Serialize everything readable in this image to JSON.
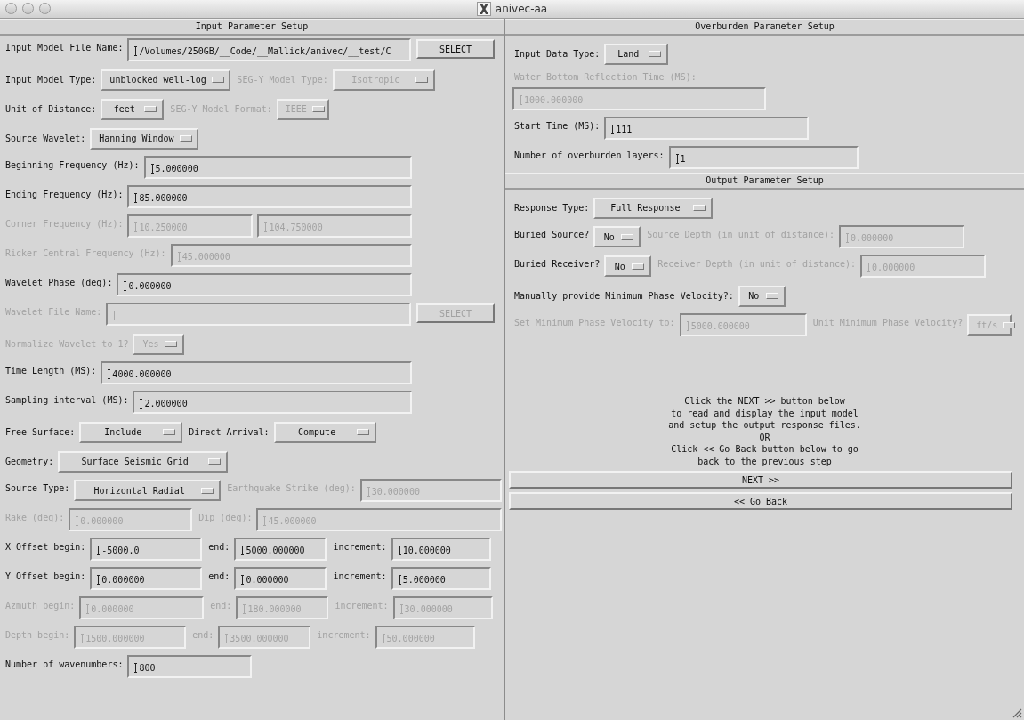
{
  "window": {
    "title": "anivec-aa"
  },
  "input": {
    "title": "Input Parameter Setup",
    "rows": [
      {
        "items": [
          {
            "kind": "label",
            "text": "Input Model File Name:",
            "disabled": false
          },
          {
            "kind": "field",
            "value": "/Volumes/250GB/__Code/__Mallick/anivec/__test/C",
            "disabled": false
          },
          {
            "kind": "button",
            "text": "SELECT",
            "disabled": false
          }
        ]
      },
      {
        "items": [
          {
            "kind": "label",
            "text": "Input Model Type:",
            "disabled": false
          },
          {
            "kind": "menu",
            "text": "unblocked well-log",
            "disabled": false
          },
          {
            "kind": "label",
            "text": "SEG-Y Model Type:",
            "disabled": true
          },
          {
            "kind": "menu",
            "text": "Isotropic",
            "disabled": true
          }
        ]
      },
      {
        "items": [
          {
            "kind": "label",
            "text": "Unit of Distance:",
            "disabled": false
          },
          {
            "kind": "menu",
            "text": "feet",
            "disabled": false
          },
          {
            "kind": "label",
            "text": "SEG-Y Model Format:",
            "disabled": true
          },
          {
            "kind": "menu",
            "text": "IEEE",
            "disabled": true
          }
        ]
      },
      {
        "items": [
          {
            "kind": "label",
            "text": "Source Wavelet:",
            "disabled": false
          },
          {
            "kind": "menu",
            "text": "Hanning Window",
            "disabled": false
          }
        ]
      },
      {
        "items": [
          {
            "kind": "label",
            "text": "Beginning Frequency (Hz):",
            "disabled": false
          },
          {
            "kind": "field",
            "value": "5.000000",
            "disabled": false
          }
        ]
      },
      {
        "items": [
          {
            "kind": "label",
            "text": "Ending Frequency (Hz):",
            "disabled": false
          },
          {
            "kind": "field",
            "value": "85.000000",
            "disabled": false
          }
        ]
      },
      {
        "items": [
          {
            "kind": "label",
            "text": "Corner Frequency (Hz):",
            "disabled": true
          },
          {
            "kind": "field",
            "value": "10.250000",
            "disabled": true
          },
          {
            "kind": "field",
            "value": "104.750000",
            "disabled": true
          }
        ]
      },
      {
        "items": [
          {
            "kind": "label",
            "text": "Ricker Central Frequency (Hz):",
            "disabled": true
          },
          {
            "kind": "field",
            "value": "45.000000",
            "disabled": true
          }
        ]
      },
      {
        "items": [
          {
            "kind": "label",
            "text": "Wavelet Phase (deg):",
            "disabled": false
          },
          {
            "kind": "field",
            "value": "0.000000",
            "disabled": false
          }
        ]
      },
      {
        "items": [
          {
            "kind": "label",
            "text": "Wavelet File Name:",
            "disabled": true
          },
          {
            "kind": "field",
            "value": "",
            "disabled": true
          },
          {
            "kind": "button",
            "text": "SELECT",
            "disabled": true
          }
        ]
      },
      {
        "items": [
          {
            "kind": "label",
            "text": "Normalize Wavelet to 1?",
            "disabled": true
          },
          {
            "kind": "menu",
            "text": "Yes",
            "disabled": true
          }
        ]
      },
      {
        "items": [
          {
            "kind": "label",
            "text": "Time Length (MS):",
            "disabled": false
          },
          {
            "kind": "field",
            "value": "4000.000000",
            "disabled": false
          }
        ]
      },
      {
        "items": [
          {
            "kind": "label",
            "text": "Sampling interval (MS):",
            "disabled": false
          },
          {
            "kind": "field",
            "value": "2.000000",
            "disabled": false
          }
        ]
      },
      {
        "items": [
          {
            "kind": "label",
            "text": "Free Surface:",
            "disabled": false
          },
          {
            "kind": "menu",
            "text": "Include",
            "disabled": false
          },
          {
            "kind": "label",
            "text": "Direct Arrival:",
            "disabled": false
          },
          {
            "kind": "menu",
            "text": "Compute",
            "disabled": false
          }
        ]
      },
      {
        "items": [
          {
            "kind": "label",
            "text": "Geometry:",
            "disabled": false
          },
          {
            "kind": "menu",
            "text": "Surface Seismic Grid",
            "disabled": false
          }
        ]
      },
      {
        "items": [
          {
            "kind": "label",
            "text": "Source Type:",
            "disabled": false
          },
          {
            "kind": "menu",
            "text": "Horizontal Radial",
            "disabled": false
          },
          {
            "kind": "label",
            "text": "Earthquake Strike (deg):",
            "disabled": true
          },
          {
            "kind": "field",
            "value": "30.000000",
            "disabled": true
          }
        ]
      },
      {
        "items": [
          {
            "kind": "label",
            "text": "Rake (deg):",
            "disabled": true
          },
          {
            "kind": "field",
            "value": "0.000000",
            "disabled": true
          },
          {
            "kind": "label",
            "text": "Dip (deg):",
            "disabled": true
          },
          {
            "kind": "field",
            "value": "45.000000",
            "disabled": true
          }
        ]
      },
      {
        "items": [
          {
            "kind": "label",
            "text": "X Offset begin:",
            "disabled": false
          },
          {
            "kind": "field",
            "value": "-5000.0",
            "disabled": false
          },
          {
            "kind": "label",
            "text": "end:",
            "disabled": false
          },
          {
            "kind": "field",
            "value": "5000.000000",
            "disabled": false
          },
          {
            "kind": "label",
            "text": "increment:",
            "disabled": false
          },
          {
            "kind": "field",
            "value": "10.000000",
            "disabled": false
          }
        ]
      },
      {
        "items": [
          {
            "kind": "label",
            "text": "Y Offset begin:",
            "disabled": false
          },
          {
            "kind": "field",
            "value": "0.000000",
            "disabled": false
          },
          {
            "kind": "label",
            "text": "end:",
            "disabled": false
          },
          {
            "kind": "field",
            "value": "0.000000",
            "disabled": false
          },
          {
            "kind": "label",
            "text": "increment:",
            "disabled": false
          },
          {
            "kind": "field",
            "value": "5.000000",
            "disabled": false
          }
        ]
      },
      {
        "items": [
          {
            "kind": "label",
            "text": "Azmuth begin:",
            "disabled": true
          },
          {
            "kind": "field",
            "value": "0.000000",
            "disabled": true
          },
          {
            "kind": "label",
            "text": "end:",
            "disabled": true
          },
          {
            "kind": "field",
            "value": "180.000000",
            "disabled": true
          },
          {
            "kind": "label",
            "text": "increment:",
            "disabled": true
          },
          {
            "kind": "field",
            "value": "30.000000",
            "disabled": true
          }
        ]
      },
      {
        "items": [
          {
            "kind": "label",
            "text": "Depth begin:",
            "disabled": true
          },
          {
            "kind": "field",
            "value": "1500.000000",
            "disabled": true
          },
          {
            "kind": "label",
            "text": "end:",
            "disabled": true
          },
          {
            "kind": "field",
            "value": "3500.000000",
            "disabled": true
          },
          {
            "kind": "label",
            "text": "increment:",
            "disabled": true
          },
          {
            "kind": "field",
            "value": "50.000000",
            "disabled": true
          }
        ]
      },
      {
        "items": [
          {
            "kind": "label",
            "text": "Number of wavenumbers:",
            "disabled": false
          },
          {
            "kind": "field",
            "value": "800",
            "disabled": false
          }
        ]
      }
    ]
  },
  "overburden": {
    "title": "Overburden Parameter Setup",
    "rows": [
      {
        "items": [
          {
            "kind": "label",
            "text": "Input Data Type:",
            "disabled": false
          },
          {
            "kind": "menu",
            "text": "Land",
            "disabled": false
          }
        ]
      },
      {
        "items": [
          {
            "kind": "label",
            "text": "Water Bottom Reflection Time (MS):",
            "disabled": true
          }
        ]
      },
      {
        "items": [
          {
            "kind": "field",
            "value": "1000.000000",
            "disabled": true
          }
        ]
      },
      {
        "items": [
          {
            "kind": "label",
            "text": "Start Time (MS):",
            "disabled": false
          },
          {
            "kind": "field",
            "value": "111",
            "disabled": false
          }
        ]
      },
      {
        "items": [
          {
            "kind": "label",
            "text": "Number of overburden layers:",
            "disabled": false
          },
          {
            "kind": "field",
            "value": "1",
            "disabled": false
          }
        ]
      }
    ]
  },
  "output": {
    "title": "Output Parameter Setup",
    "rows": [
      {
        "items": [
          {
            "kind": "label",
            "text": "Response Type:",
            "disabled": false
          },
          {
            "kind": "menu",
            "text": "Full Response",
            "disabled": false
          }
        ]
      },
      {
        "items": [
          {
            "kind": "label",
            "text": "Buried Source?",
            "disabled": false
          },
          {
            "kind": "menu",
            "text": "No",
            "disabled": false
          },
          {
            "kind": "label",
            "text": "Source Depth (in unit of distance):",
            "disabled": true
          },
          {
            "kind": "field",
            "value": "0.000000",
            "disabled": true
          }
        ]
      },
      {
        "items": [
          {
            "kind": "label",
            "text": "Buried Receiver?",
            "disabled": false
          },
          {
            "kind": "menu",
            "text": "No",
            "disabled": false
          },
          {
            "kind": "label",
            "text": "Receiver Depth (in unit of distance):",
            "disabled": true
          },
          {
            "kind": "field",
            "value": "0.000000",
            "disabled": true
          }
        ]
      },
      {
        "items": [
          {
            "kind": "label",
            "text": "Manually provide Minimum Phase Velocity?:",
            "disabled": false
          },
          {
            "kind": "menu",
            "text": "No",
            "disabled": false
          }
        ]
      },
      {
        "items": [
          {
            "kind": "label",
            "text": "Set Minimum Phase Velocity to:",
            "disabled": true
          },
          {
            "kind": "field",
            "value": "5000.000000",
            "disabled": true
          },
          {
            "kind": "label",
            "text": "Unit Minimum Phase Velocity?",
            "disabled": true
          },
          {
            "kind": "menu",
            "text": "ft/s",
            "disabled": true
          }
        ]
      }
    ],
    "instructions": "Click the NEXT >> button below\nto read and display the input model\nand setup the output response files.\nOR\nClick << Go Back button below to go\nback to the previous step",
    "buttons": [
      "NEXT >>",
      "<< Go Back"
    ]
  }
}
